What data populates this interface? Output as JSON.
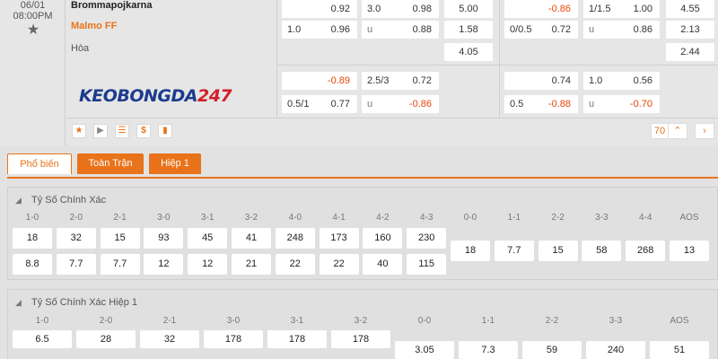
{
  "match": {
    "date": "06/01",
    "time": "08:00PM",
    "home_team": "Brommapojkarna",
    "away_team": "Malmo FF",
    "draw_label": "Hòa",
    "logo_part1": "KEOBONGDA",
    "logo_part2": "247"
  },
  "odds": {
    "full_hdp": [
      {
        "label": "",
        "value": "0.92",
        "neg": false
      },
      {
        "label": "1.0",
        "value": "0.96",
        "neg": false
      }
    ],
    "full_ou": [
      {
        "label": "3.0",
        "value": "0.98",
        "neg": false
      },
      {
        "label": "u",
        "value": "0.88",
        "neg": false
      }
    ],
    "full_1x2": [
      "5.00",
      "1.58",
      "4.05"
    ],
    "half_hdp": [
      {
        "label": "",
        "value": "-0.86",
        "neg": true
      },
      {
        "label": "0/0.5",
        "value": "0.72",
        "neg": false
      }
    ],
    "half_ou": [
      {
        "label": "1/1.5",
        "value": "1.00",
        "neg": false
      },
      {
        "label": "u",
        "value": "0.86",
        "neg": false
      }
    ],
    "half_1x2": [
      "4.55",
      "2.13",
      "2.44"
    ],
    "alt_full_hdp": [
      {
        "label": "",
        "value": "-0.89",
        "neg": true
      },
      {
        "label": "0.5/1",
        "value": "0.77",
        "neg": false
      }
    ],
    "alt_full_ou": [
      {
        "label": "2.5/3",
        "value": "0.72",
        "neg": false
      },
      {
        "label": "u",
        "value": "-0.86",
        "neg": true
      }
    ],
    "alt_half_hdp": [
      {
        "label": "",
        "value": "0.74",
        "neg": false
      },
      {
        "label": "0.5",
        "value": "-0.88",
        "neg": true
      }
    ],
    "alt_half_ou": [
      {
        "label": "1.0",
        "value": "0.56",
        "neg": false
      },
      {
        "label": "u",
        "value": "-0.70",
        "neg": true
      }
    ]
  },
  "toolbar": {
    "more_count": "70"
  },
  "tabs": [
    "Phổ biến",
    "Toàn Trận",
    "Hiệp 1"
  ],
  "section1": {
    "title": "Tỷ Số Chính Xác",
    "headers": [
      "1-0",
      "2-0",
      "2-1",
      "3-0",
      "3-1",
      "3-2",
      "4-0",
      "4-1",
      "4-2",
      "4-3",
      "0-0",
      "1-1",
      "2-2",
      "3-3",
      "4-4",
      "AOS"
    ],
    "row1": [
      "18",
      "32",
      "15",
      "93",
      "45",
      "41",
      "248",
      "173",
      "160",
      "230"
    ],
    "row2": [
      "8.8",
      "7.7",
      "7.7",
      "12",
      "12",
      "21",
      "22",
      "22",
      "40",
      "115"
    ],
    "mid": [
      "18",
      "7.7",
      "15",
      "58",
      "268",
      "13"
    ]
  },
  "section2": {
    "title": "Tỷ Số Chính Xác Hiệp 1",
    "headers": [
      "1-0",
      "2-0",
      "2-1",
      "3-0",
      "3-1",
      "3-2",
      "0-0",
      "1-1",
      "2-2",
      "3-3",
      "AOS"
    ],
    "row1": [
      "6.5",
      "28",
      "32",
      "178",
      "178",
      "178"
    ],
    "mid": [
      "3.05",
      "7.3",
      "59",
      "240",
      "51"
    ]
  }
}
